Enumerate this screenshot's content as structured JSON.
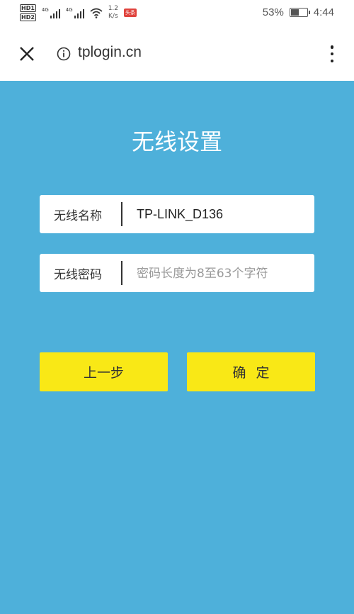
{
  "status_bar": {
    "hd_labels": [
      "HD1",
      "HD2"
    ],
    "network_labels": [
      "4G",
      "4G"
    ],
    "speed_value": "1.2",
    "speed_unit": "K/s",
    "badge": "头条",
    "battery_percent": "53%",
    "battery_level": 0.53,
    "time": "4:44"
  },
  "browser": {
    "url": "tplogin.cn",
    "icons": [
      "close-icon",
      "info-icon",
      "more-vertical-icon"
    ]
  },
  "page": {
    "title": "无线设置",
    "wireless_name": {
      "label": "无线名称",
      "value": "TP-LINK_D136"
    },
    "wireless_password": {
      "label": "无线密码",
      "placeholder": "密码长度为8至63个字符"
    },
    "buttons": {
      "previous": "上一步",
      "confirm": "确定"
    }
  },
  "colors": {
    "background": "#4eb0da",
    "button": "#f9e816"
  }
}
